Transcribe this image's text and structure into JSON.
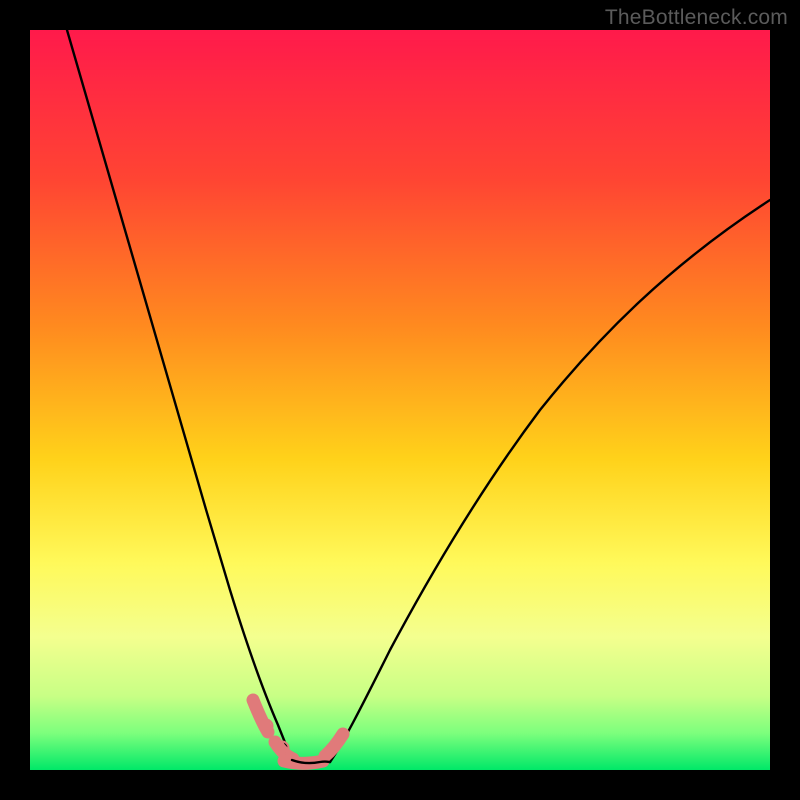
{
  "watermark": "TheBottleneck.com",
  "chart_data": {
    "type": "line",
    "title": "",
    "xlabel": "",
    "ylabel": "",
    "xlim": [
      0,
      100
    ],
    "ylim": [
      0,
      100
    ],
    "grid": false,
    "legend": false,
    "gradient_stops": [
      {
        "offset": 0.0,
        "color": "#ff1a4b"
      },
      {
        "offset": 0.2,
        "color": "#ff4433"
      },
      {
        "offset": 0.4,
        "color": "#ff8a1f"
      },
      {
        "offset": 0.58,
        "color": "#ffd21a"
      },
      {
        "offset": 0.72,
        "color": "#fff95a"
      },
      {
        "offset": 0.82,
        "color": "#f4ff8f"
      },
      {
        "offset": 0.9,
        "color": "#c8ff85"
      },
      {
        "offset": 0.95,
        "color": "#7dff7d"
      },
      {
        "offset": 1.0,
        "color": "#00e868"
      }
    ],
    "series": [
      {
        "name": "left-branch",
        "stroke": "#000000",
        "x": [
          5,
          8,
          11,
          14,
          17,
          20,
          23,
          26,
          28,
          30,
          31.5,
          33,
          34
        ],
        "y": [
          100,
          89,
          78,
          67,
          56,
          45,
          35,
          25,
          17,
          10,
          6,
          3,
          1
        ]
      },
      {
        "name": "right-branch",
        "stroke": "#000000",
        "x": [
          40,
          42,
          45,
          50,
          55,
          60,
          66,
          72,
          78,
          85,
          92,
          100
        ],
        "y": [
          1,
          4,
          9,
          17,
          25,
          33,
          41,
          49,
          56,
          63,
          70,
          77
        ]
      },
      {
        "name": "valley-floor-marker",
        "stroke": "#e07a7a",
        "x": [
          30,
          32,
          34,
          36,
          38,
          40,
          42
        ],
        "y": [
          8,
          3,
          1,
          1,
          1,
          1,
          4
        ]
      }
    ],
    "annotations": []
  }
}
